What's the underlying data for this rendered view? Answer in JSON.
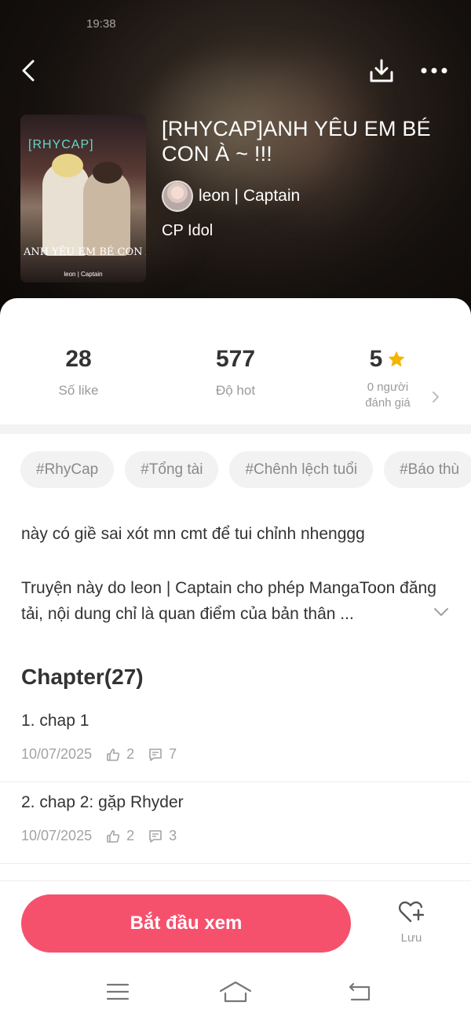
{
  "header": {
    "status_time": "19:38",
    "back_icon": "chevron-left-icon",
    "download_icon": "download-icon",
    "more_icon": "more-horizontal-icon"
  },
  "story": {
    "title": "[RHYCAP]ANH YÊU EM BÉ CON À ~ !!!",
    "author": "leon | Captain",
    "category": "CP Idol",
    "cover": {
      "tag": "[RHYCAP]",
      "title": "ANH YÊU EM BÉ CON À ~ !!!",
      "author": "leon | Captain"
    }
  },
  "stats": {
    "likes_value": "28",
    "likes_label": "Số like",
    "hot_value": "577",
    "hot_label": "Độ hot",
    "rating_value": "5",
    "rating_label_line1": "0 người",
    "rating_label_line2": "đánh giá"
  },
  "tags": [
    "#RhyCap",
    "#Tổng tài",
    "#Chênh lệch tuổi",
    "#Báo thù"
  ],
  "description": {
    "line1": "này có giề sai xót mn cmt để tui chỉnh nhenggg",
    "line2": "Truyện này do leon | Captain cho phép MangaToon đăng tải, nội dung chỉ là quan điểm của bản thân ..."
  },
  "chapters": {
    "heading": "Chapter(27)",
    "items": [
      {
        "title": "1. chap 1",
        "date": "10/07/2025",
        "likes": "2",
        "comments": "7"
      },
      {
        "title": "2. chap 2: gặp Rhyder",
        "date": "10/07/2025",
        "likes": "2",
        "comments": "3"
      }
    ]
  },
  "actions": {
    "start_label": "Bắt đầu xem",
    "save_label": "Lưu"
  },
  "colors": {
    "accent": "#f5516d",
    "star": "#f5b400",
    "tag_bg": "#f2f2f2"
  }
}
